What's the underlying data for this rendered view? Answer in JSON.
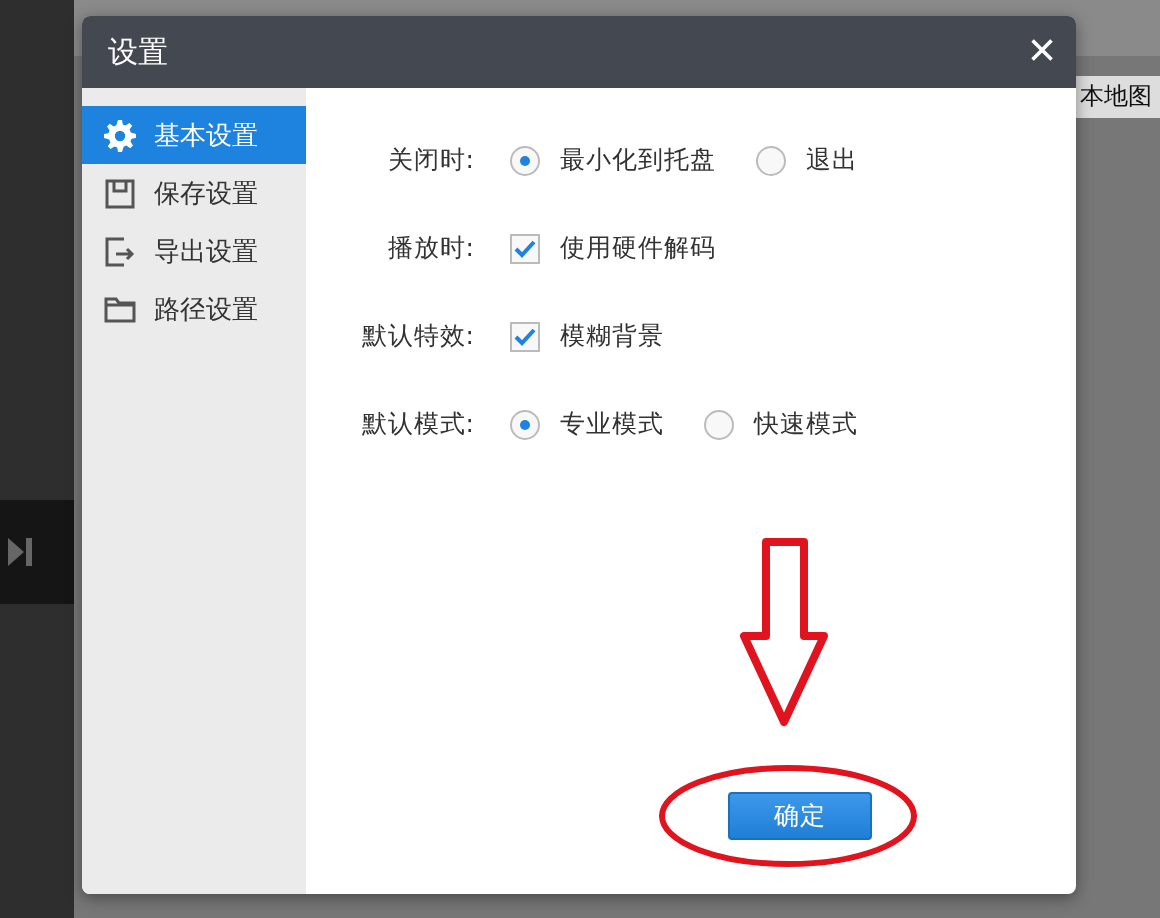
{
  "background": {
    "side_label": "本地图"
  },
  "dialog": {
    "title": "设置",
    "close": "×",
    "sidebar": [
      {
        "label": "基本设置",
        "selected": true
      },
      {
        "label": "保存设置",
        "selected": false
      },
      {
        "label": "导出设置",
        "selected": false
      },
      {
        "label": "路径设置",
        "selected": false
      }
    ],
    "settings": [
      {
        "label": "关闭时:",
        "kind": "radio",
        "options": [
          {
            "label": "最小化到托盘",
            "selected": true
          },
          {
            "label": "退出",
            "selected": false
          }
        ]
      },
      {
        "label": "播放时:",
        "kind": "checkbox",
        "options": [
          {
            "label": "使用硬件解码",
            "checked": true
          }
        ]
      },
      {
        "label": "默认特效:",
        "kind": "checkbox",
        "options": [
          {
            "label": "模糊背景",
            "checked": true
          }
        ]
      },
      {
        "label": "默认模式:",
        "kind": "radio",
        "options": [
          {
            "label": "专业模式",
            "selected": true
          },
          {
            "label": "快速模式",
            "selected": false
          }
        ]
      }
    ],
    "ok_button": "确定"
  }
}
